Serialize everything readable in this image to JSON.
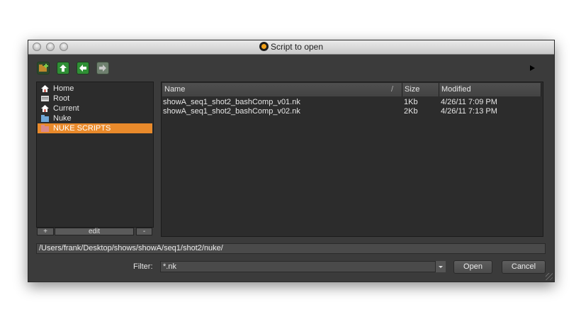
{
  "window": {
    "title": "Script to open"
  },
  "toolbar": {
    "buttons": [
      "new-folder",
      "up",
      "back",
      "forward"
    ],
    "colors": {
      "folder": "#c08a2c",
      "green": "#2f8f35",
      "disabled": "#6e7f6e"
    }
  },
  "bookmarks": {
    "items": [
      {
        "label": "Home",
        "icon": "home-icon"
      },
      {
        "label": "Root",
        "icon": "drive-icon"
      },
      {
        "label": "Current",
        "icon": "home-icon"
      },
      {
        "label": "Nuke",
        "icon": "folder-icon"
      },
      {
        "label": "NUKE SCRIPTS",
        "icon": "folder-icon",
        "selected": true
      }
    ],
    "add_label": "+",
    "edit_label": "edit",
    "remove_label": "-",
    "selected_color": "#e98a2b"
  },
  "files": {
    "columns": {
      "name": "Name",
      "sort_mark": "/",
      "size": "Size",
      "modified": "Modified"
    },
    "rows": [
      {
        "name": "showA_seq1_shot2_bashComp_v01.nk",
        "size": "1Kb",
        "modified": "4/26/11 7:09 PM"
      },
      {
        "name": "showA_seq1_shot2_bashComp_v02.nk",
        "size": "2Kb",
        "modified": "4/26/11 7:13 PM"
      }
    ]
  },
  "path": {
    "value": "/Users/frank/Desktop/shows/showA/seq1/shot2/nuke/"
  },
  "filter": {
    "label": "Filter:",
    "value": "*.nk"
  },
  "actions": {
    "open_label": "Open",
    "cancel_label": "Cancel"
  }
}
